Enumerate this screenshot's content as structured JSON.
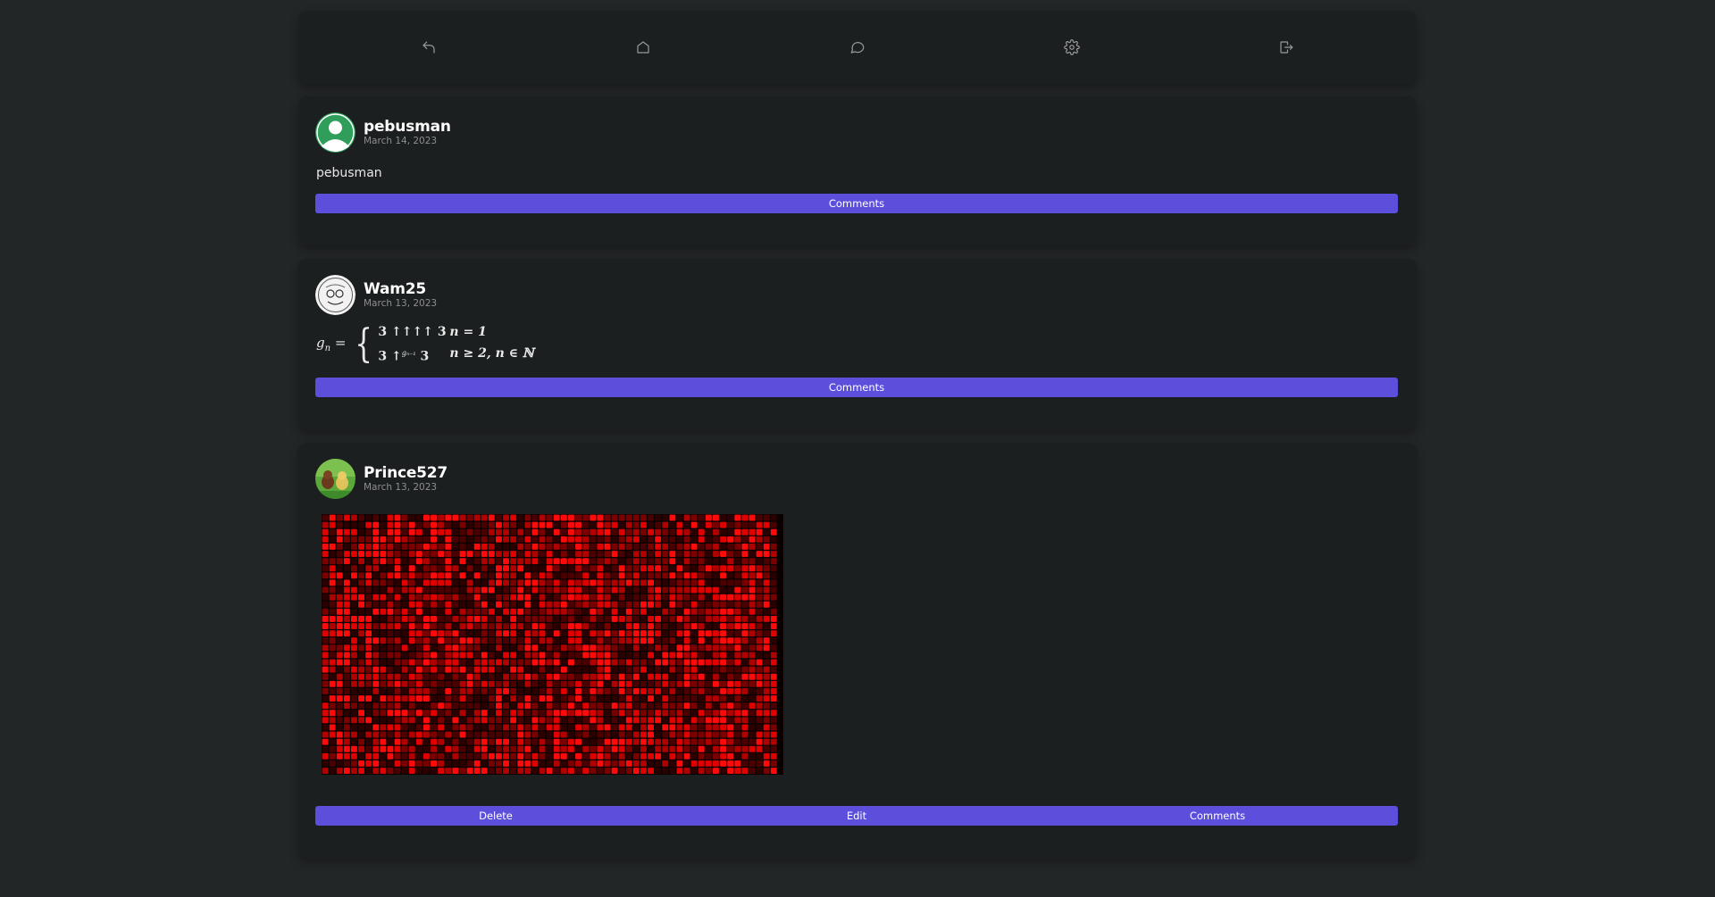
{
  "nav": {
    "items": [
      {
        "icon": "back-arrow-icon"
      },
      {
        "icon": "home-icon"
      },
      {
        "icon": "chat-bubble-icon"
      },
      {
        "icon": "gear-icon"
      },
      {
        "icon": "logout-icon"
      }
    ]
  },
  "posts": [
    {
      "username": "pebusman",
      "date": "March 14, 2023",
      "text": "pebusman",
      "avatar": "default-user-avatar",
      "buttons": [
        "Comments"
      ]
    },
    {
      "username": "Wam25",
      "date": "March 13, 2023",
      "avatar": "sketch-face-avatar",
      "math": {
        "lhs": "g",
        "lhs_sub": "n",
        "eq": "=",
        "rows": [
          {
            "expr": "3 ↑↑↑↑ 3",
            "sup": "",
            "cond": "n = 1"
          },
          {
            "expr": "3 ↑",
            "sup": "gₙ₋₁",
            "expr_tail": " 3",
            "cond": "n ≥ 2, n ∈ ℕ"
          }
        ]
      },
      "buttons": [
        "Comments"
      ]
    },
    {
      "username": "Prince527",
      "date": "March 13, 2023",
      "avatar": "cartoon-dogs-avatar",
      "image": "red-pixel-grid-image",
      "buttons": [
        "Delete",
        "Edit",
        "Comments"
      ]
    }
  ],
  "colors": {
    "page_bg": "#232627",
    "card_bg": "#1c1f20",
    "button_bg": "#5b4fdb",
    "avatar_green": "#2f9e5a",
    "grid_red": "#e00000"
  }
}
